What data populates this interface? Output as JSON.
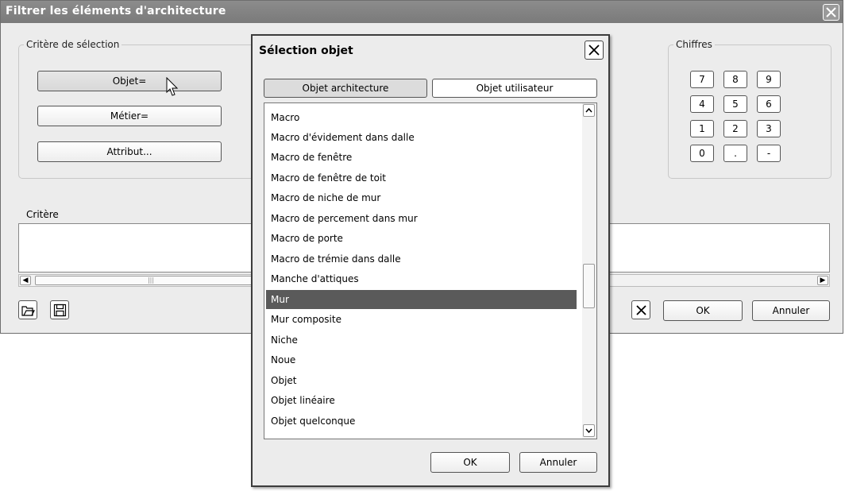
{
  "main_window": {
    "title": "Filtrer les éléments d'architecture",
    "selection_group": {
      "legend": "Critère de sélection",
      "buttons": [
        "Objet=",
        "Métier=",
        "Attribut..."
      ]
    },
    "digits_group": {
      "legend": "Chiffres",
      "keys": [
        "7",
        "8",
        "9",
        "4",
        "5",
        "6",
        "1",
        "2",
        "3",
        "0",
        ".",
        "-"
      ]
    },
    "criteria": {
      "label": "Critère",
      "value": ""
    },
    "ok_label": "OK",
    "cancel_label": "Annuler",
    "icons": {
      "open": "folder-open-icon",
      "save": "floppy-save-icon",
      "delete": "delete-x-icon"
    }
  },
  "modal": {
    "title": "Sélection objet",
    "tabs": [
      {
        "label": "Objet architecture",
        "active": true
      },
      {
        "label": "Objet utilisateur",
        "active": false
      }
    ],
    "items": [
      "Macro",
      "Macro d'évidement dans dalle",
      "Macro de fenêtre",
      "Macro de fenêtre de toit",
      "Macro de niche de mur",
      "Macro de percement dans mur",
      "Macro de porte",
      "Macro de trémie dans dalle",
      "Manche d'attiques",
      "Mur",
      "Mur composite",
      "Niche",
      "Noue",
      "Objet",
      "Objet linéaire",
      "Objet quelconque"
    ],
    "selected_item": "Mur",
    "ok_label": "OK",
    "cancel_label": "Annuler"
  },
  "colors": {
    "title_bar": "#7f7f7f",
    "selection": "#5a5a5a",
    "dialog_bg": "#ececec"
  }
}
